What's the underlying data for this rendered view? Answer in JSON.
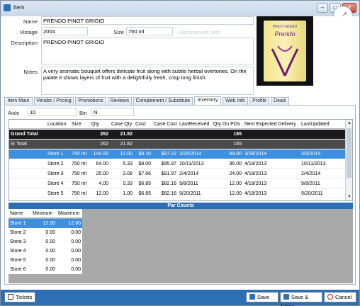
{
  "window": {
    "title": "Item"
  },
  "item": {
    "name_label": "Name",
    "name_value": "PRENDO PINOT GRIGIO",
    "vintage_label": "Vintage",
    "vintage_value": "2004",
    "size_label": "Size",
    "size_value": "750 ml",
    "ghost_text": "Discontinued Item",
    "description_label": "Description",
    "description_value": "PRENDO PINOT GRIGIO",
    "notes_label": "Notes",
    "notes_value": "A very aromatic bouquet offers delicate fruit along with subtle herbal overtones. On the palate it shows layers of fruit with a delightfully fresh, crisp long finish.",
    "label_brand": "PINOT GRIGIO",
    "label_name": "Prendo"
  },
  "tabs": [
    "Item Main",
    "Vendor / Pricing",
    "Promotions",
    "Reviews",
    "Complement / Substitute",
    "Inventory",
    "Web Info",
    "Profile",
    "Deals"
  ],
  "active_tab": "Inventory",
  "inventory": {
    "aisle_label": "Aisle",
    "aisle_value": "10",
    "bin_label": "Bin",
    "bin_value": "N",
    "columns": [
      "",
      "Location",
      "Size",
      "Qty",
      "Case Qty",
      "Cost",
      "Case Cost",
      "LastReceived",
      "Qty On POs",
      "Next Expected Delivery",
      "LastUpdated"
    ],
    "grand_total": {
      "label": "Grand Total",
      "qty": "262",
      "case_qty": "21.82",
      "qty_on_pos": "165"
    },
    "total": {
      "label": "Total",
      "qty": "262",
      "case_qty": "21.82",
      "qty_on_pos": "165"
    },
    "rows": [
      {
        "location": "Store 1",
        "size": "750 ml",
        "qty": "144.00",
        "case_qty": "12.00",
        "cost": "$8.10",
        "case_cost": "$97.22",
        "last_received": "2/25/2014",
        "qty_on_pos": "69.00",
        "next_delivery": "3/28/2014",
        "last_updated": "3/5/2014"
      },
      {
        "location": "Store 2",
        "size": "750 ml",
        "qty": "64.00",
        "case_qty": "5.33",
        "cost": "$8.00",
        "case_cost": "$95.97",
        "last_received": "10/11/2013",
        "qty_on_pos": "36.00",
        "next_delivery": "4/18/2013",
        "last_updated": "10/11/2013"
      },
      {
        "location": "Store 3",
        "size": "750 ml",
        "qty": "25.00",
        "case_qty": "2.08",
        "cost": "$7.66",
        "case_cost": "$91.97",
        "last_received": "2/4/2014",
        "qty_on_pos": "24.00",
        "next_delivery": "4/18/2013",
        "last_updated": "2/4/2014"
      },
      {
        "location": "Store 4",
        "size": "750 ml",
        "qty": "4.00",
        "case_qty": "0.33",
        "cost": "$6.85",
        "case_cost": "$82.16",
        "last_received": "9/8/2011",
        "qty_on_pos": "12.00",
        "next_delivery": "4/18/2013",
        "last_updated": "9/8/2011"
      },
      {
        "location": "Store 5",
        "size": "750 ml",
        "qty": "12.00",
        "case_qty": "1.00",
        "cost": "$6.85",
        "case_cost": "$82.16",
        "last_received": "9/20/2011",
        "qty_on_pos": "12.00",
        "next_delivery": "4/18/2013",
        "last_updated": "9/20/2011"
      }
    ]
  },
  "par_counts": {
    "title": "Par Counts",
    "columns": [
      "Name",
      "Minimum",
      "Maximum"
    ],
    "rows": [
      {
        "name": "Store 1",
        "minimum": "12.00",
        "maximum": "12.00"
      },
      {
        "name": "Store 2",
        "minimum": "0.00",
        "maximum": "0.00"
      },
      {
        "name": "Store 3",
        "minimum": "0.00",
        "maximum": "0.00"
      },
      {
        "name": "Store 4",
        "minimum": "0.00",
        "maximum": "0.00"
      },
      {
        "name": "Store 5",
        "minimum": "0.00",
        "maximum": "0.00"
      },
      {
        "name": "Store 6",
        "minimum": "0.00",
        "maximum": "0.00"
      }
    ]
  },
  "footer": {
    "tickets_label": "Tickets",
    "save_label": "Save",
    "save_close_label": "Save & Close",
    "cancel_label": "Cancel"
  },
  "colors": {
    "accent": "#2c6fb4",
    "selection": "#3d8fe0",
    "grand_total": "#1a1a1a"
  }
}
